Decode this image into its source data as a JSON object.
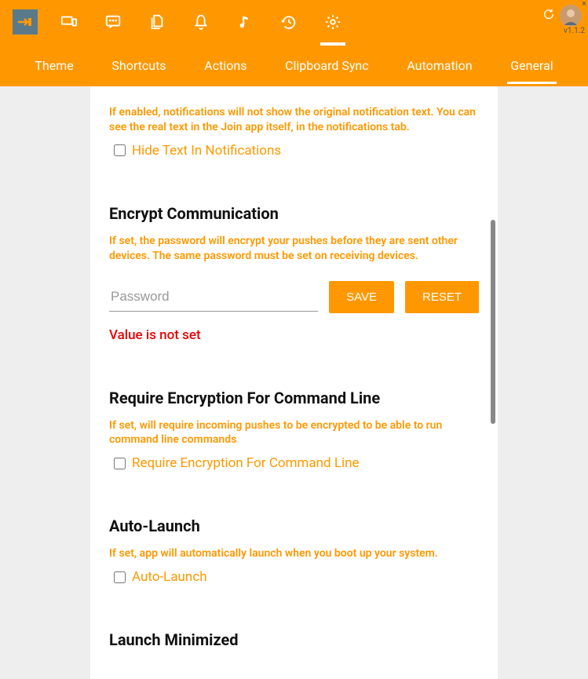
{
  "version": "v1.1.2",
  "tabs": {
    "theme": "Theme",
    "shortcuts": "Shortcuts",
    "actions": "Actions",
    "clipboard": "Clipboard Sync",
    "automation": "Automation",
    "general": "General"
  },
  "hideText": {
    "desc": "If enabled, notifications will not show the original notification text. You can see the real text in the Join app itself, in the notifications tab.",
    "label": "Hide Text In Notifications"
  },
  "encrypt": {
    "title": "Encrypt Communication",
    "desc": "If set, the password will encrypt your pushes before they are sent other devices. The same password must be set on receiving devices.",
    "placeholder": "Password",
    "save": "SAVE",
    "reset": "RESET",
    "error": "Value is not set"
  },
  "requireEnc": {
    "title": "Require Encryption For Command Line",
    "desc": "If set, will require incoming pushes to be encrypted to be able to run command line commands",
    "label": "Require Encryption For Command Line"
  },
  "autoLaunch": {
    "title": "Auto-Launch",
    "desc": "If set, app will automatically launch when you boot up your system.",
    "label": "Auto-Launch"
  },
  "launchMin": {
    "title": "Launch Minimized"
  }
}
